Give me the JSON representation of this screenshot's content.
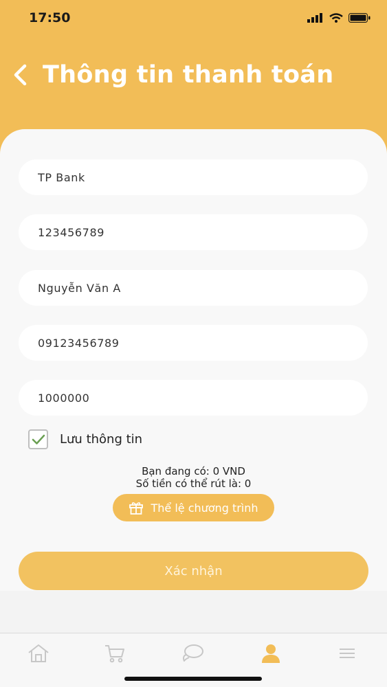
{
  "status_bar": {
    "time": "17:50"
  },
  "header": {
    "title": "Thông tin thanh toán"
  },
  "form": {
    "bank": "TP Bank",
    "account_number": "123456789",
    "account_name": "Nguyễn Văn A",
    "phone": "09123456789",
    "amount": "1000000"
  },
  "save_info": {
    "label": "Lưu thông tin",
    "checked": true
  },
  "balance": {
    "current": "Bạn đang có: 0 VND",
    "withdrawable": "Số tiền có thể rút là: 0"
  },
  "rules_button": {
    "label": "Thể lệ chương trình"
  },
  "confirm_button": {
    "label": "Xác nhận"
  },
  "tabbar": {
    "items": [
      {
        "icon": "home-icon",
        "active": false
      },
      {
        "icon": "cart-icon",
        "active": false
      },
      {
        "icon": "chat-icon",
        "active": false
      },
      {
        "icon": "user-icon",
        "active": true
      },
      {
        "icon": "menu-icon",
        "active": false
      }
    ]
  },
  "colors": {
    "accent": "#f2bd57",
    "check": "#6a9f52",
    "tab_inactive": "#c7c7c7"
  }
}
